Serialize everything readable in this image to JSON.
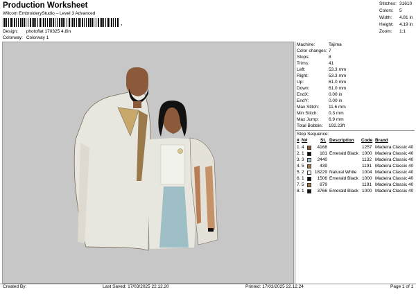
{
  "header": {
    "title": "Production Worksheet",
    "subtitle": "Wilcom EmbroideryStudio – Level 3 Advanced",
    "barcode_mark": ","
  },
  "design_info": [
    {
      "label": "Design:",
      "value": "photoflat 170325 4,8in"
    },
    {
      "label": "Colorway:",
      "value": "Colorway 1"
    }
  ],
  "stats": [
    {
      "label": "Stitches:",
      "value": "31610"
    },
    {
      "label": "Colors:",
      "value": "5"
    },
    {
      "label": "Width:",
      "value": "4.81 in"
    },
    {
      "label": "Height:",
      "value": "4.19 in"
    },
    {
      "label": "Zoom:",
      "value": "1:1"
    }
  ],
  "machine": [
    {
      "label": "Machine:",
      "value": "Tajima"
    },
    {
      "label": "Color changes:",
      "value": "7"
    },
    {
      "label": "Stops:",
      "value": "8"
    },
    {
      "label": "Trims:",
      "value": "41"
    },
    {
      "label": "Left:",
      "value": "53.3 mm"
    },
    {
      "label": "Right:",
      "value": "53.3 mm"
    },
    {
      "label": "Up:",
      "value": "61.0 mm"
    },
    {
      "label": "Down:",
      "value": "61.0 mm"
    },
    {
      "label": "EndX:",
      "value": "0.00 in"
    },
    {
      "label": "EndY:",
      "value": "0.00 in"
    },
    {
      "label": "Max Stitch:",
      "value": "11.6 mm"
    },
    {
      "label": "Min Stitch:",
      "value": "0.3 mm"
    },
    {
      "label": "Max Jump:",
      "value": "6.9 mm"
    },
    {
      "label": "Total Bobbin:",
      "value": "192.23ft"
    }
  ],
  "stop_sequence": {
    "title": "Stop Sequence:",
    "headers": {
      "num": "#",
      "n": "N#",
      "st": "St.",
      "description": "Description",
      "code": "Code",
      "brand": "Brand"
    },
    "rows": [
      {
        "num": "1.",
        "n": "4",
        "color": "#8a5a3a",
        "st": "4168",
        "description": "",
        "code": "1257",
        "brand": "Madeira Classic 40"
      },
      {
        "num": "2.",
        "n": "1",
        "color": "#111111",
        "st": "181",
        "description": "Emerald Black",
        "code": "1000",
        "brand": "Madeira Classic 40"
      },
      {
        "num": "3.",
        "n": "3",
        "color": "#9fbfc7",
        "st": "2440",
        "description": "",
        "code": "1132",
        "brand": "Madeira Classic 40"
      },
      {
        "num": "4.",
        "n": "5",
        "color": "#9a7a4a",
        "st": "439",
        "description": "",
        "code": "1191",
        "brand": "Madeira Classic 40"
      },
      {
        "num": "5.",
        "n": "2",
        "color": "#f5f5f0",
        "st": "18229",
        "description": "Natural White",
        "code": "1004",
        "brand": "Madeira Classic 40"
      },
      {
        "num": "6.",
        "n": "1",
        "color": "#111111",
        "st": "1506",
        "description": "Emerald Black",
        "code": "1000",
        "brand": "Madeira Classic 40"
      },
      {
        "num": "7.",
        "n": "5",
        "color": "#9a7a4a",
        "st": "879",
        "description": "",
        "code": "1191",
        "brand": "Madeira Classic 40"
      },
      {
        "num": "8.",
        "n": "1",
        "color": "#111111",
        "st": "3766",
        "description": "Emerald Black",
        "code": "1000",
        "brand": "Madeira Classic 40"
      }
    ]
  },
  "footer": {
    "created_by": "Created By:",
    "last_saved": "Last Saved: 17/03/2025 22.12.20",
    "printed": "Printed: 17/03/2025 22.12.24",
    "page": "Page 1 of 1"
  }
}
